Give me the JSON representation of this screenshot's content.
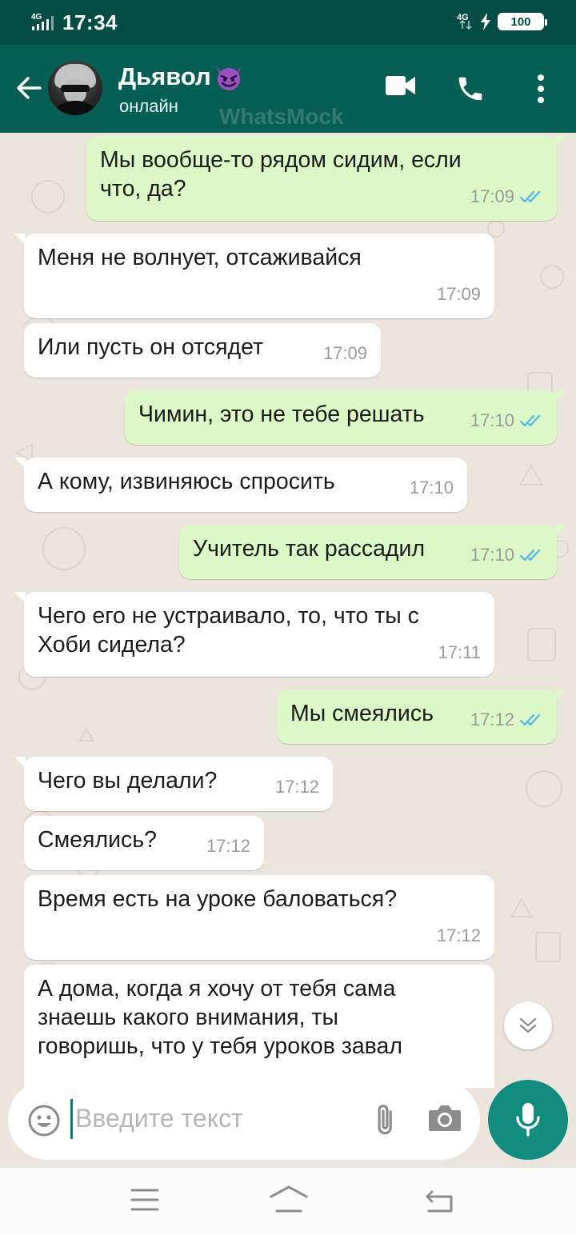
{
  "status_bar": {
    "network_left": "4G",
    "time": "17:34",
    "network_right": "4G",
    "battery": "100"
  },
  "header": {
    "contact_name": "Дьявол",
    "status": "онлайн",
    "watermark": "WhatsMock"
  },
  "messages": [
    {
      "dir": "out",
      "text": "Мы вообще-то рядом сидим, если\nчто, да?",
      "time": "17:09",
      "read": true
    },
    {
      "dir": "in",
      "text": "Меня не волнует, отсаживайся",
      "time": "17:09"
    },
    {
      "dir": "in",
      "text": "Или пусть он отсядет",
      "time": "17:09"
    },
    {
      "dir": "out",
      "text": "Чимин, это не тебе решать",
      "time": "17:10",
      "read": true
    },
    {
      "dir": "in",
      "text": "А кому, извиняюсь спросить",
      "time": "17:10"
    },
    {
      "dir": "out",
      "text": "Учитель так рассадил",
      "time": "17:10",
      "read": true
    },
    {
      "dir": "in",
      "text": "Чего его не устраивало, то, что ты с\nХоби сидела?",
      "time": "17:11"
    },
    {
      "dir": "out",
      "text": "Мы смеялись",
      "time": "17:12",
      "read": true
    },
    {
      "dir": "in",
      "text": "Чего вы делали?",
      "time": "17:12"
    },
    {
      "dir": "in",
      "text": "Смеялись?",
      "time": "17:12"
    },
    {
      "dir": "in",
      "text": "Время есть на уроке баловаться?",
      "time": "17:12"
    },
    {
      "dir": "in",
      "text": "А дома, когда я хочу от тебя сама\nзнаешь какого внимания, ты\nговоришь, что у тебя уроков завал",
      "time": ""
    }
  ],
  "input": {
    "placeholder": "Введите текст"
  },
  "colors": {
    "header": "#075e54",
    "status_bar": "#054d44",
    "outgoing_bubble": "#dcf8c6",
    "incoming_bubble": "#ffffff",
    "chat_background": "#ece5dd",
    "read_ticks": "#4fb6ec",
    "mic_button": "#128c7e"
  },
  "icons": [
    "back-arrow-icon",
    "devil-emoji-icon",
    "video-call-icon",
    "phone-icon",
    "more-vert-icon",
    "double-check-icon",
    "scroll-down-icon",
    "emoji-icon",
    "attach-icon",
    "camera-icon",
    "mic-icon",
    "menu-nav-icon",
    "home-nav-icon",
    "back-nav-icon"
  ]
}
